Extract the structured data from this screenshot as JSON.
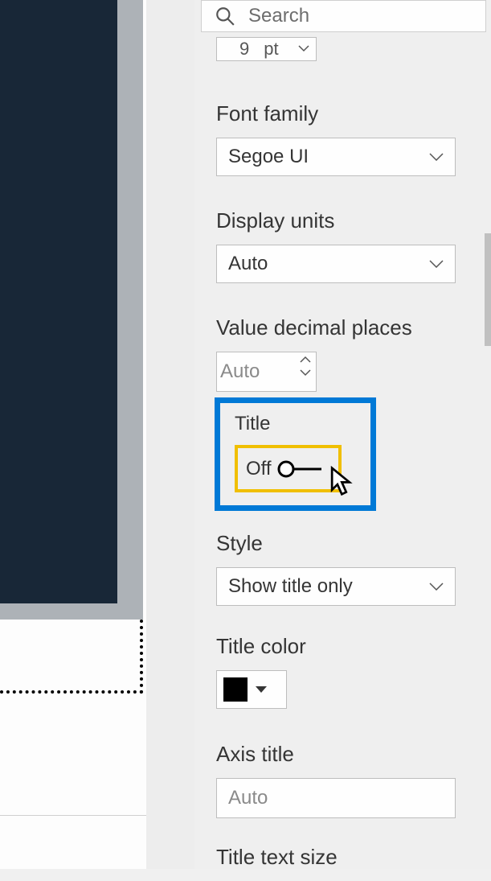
{
  "search": {
    "placeholder": "Search"
  },
  "textsize": {
    "value": "9",
    "unit": "pt"
  },
  "font_family": {
    "label": "Font family",
    "value": "Segoe UI"
  },
  "display_units": {
    "label": "Display units",
    "value": "Auto"
  },
  "value_decimal": {
    "label": "Value decimal places",
    "value": "Auto"
  },
  "title_section": {
    "label": "Title",
    "toggle_state": "Off"
  },
  "style": {
    "label": "Style",
    "value": "Show title only"
  },
  "title_color": {
    "label": "Title color",
    "value": "#000000"
  },
  "axis_title": {
    "label": "Axis title",
    "value": "Auto"
  },
  "title_text_size": {
    "label": "Title text size"
  }
}
